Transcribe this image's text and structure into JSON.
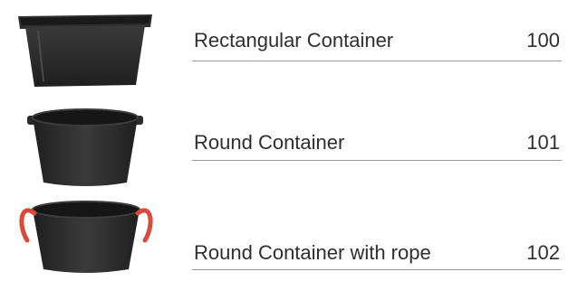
{
  "products": [
    {
      "name": "Rectangular Container",
      "code": "100",
      "image": "rectangular-container-icon"
    },
    {
      "name": "Round Container",
      "code": "101",
      "image": "round-container-icon"
    },
    {
      "name": "Round Container with rope",
      "code": "102",
      "image": "round-container-rope-icon"
    }
  ],
  "colors": {
    "container_body": "#2b2b2b",
    "rope": "#d94a3a",
    "text": "#2f2f2f",
    "rule": "#9a9a9a"
  }
}
